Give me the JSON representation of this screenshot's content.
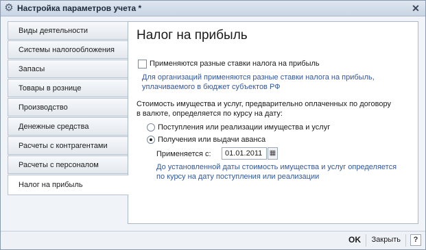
{
  "window": {
    "title": "Настройка параметров учета *"
  },
  "sidebar": {
    "items": [
      {
        "label": "Виды деятельности"
      },
      {
        "label": "Системы налогообложения"
      },
      {
        "label": "Запасы"
      },
      {
        "label": "Товары в рознице"
      },
      {
        "label": "Производство"
      },
      {
        "label": "Денежные средства"
      },
      {
        "label": "Расчеты с контрагентами"
      },
      {
        "label": "Расчеты с персоналом"
      },
      {
        "label": "Налог на прибыль",
        "active": true
      }
    ]
  },
  "main": {
    "title": "Налог на прибыль",
    "checkbox_label": "Применяются разные ставки налога на прибыль",
    "checkbox_checked": false,
    "checkbox_hint_line1": "Для организаций применяются разные ставки налога на прибыль,",
    "checkbox_hint_line2": "уплачиваемого в бюджет субъектов РФ",
    "paragraph_line1": "Стоимость имущества и услуг, предварительно оплаченных по договору",
    "paragraph_line2": "в валюте, определяется по курсу на дату:",
    "radio_options": [
      {
        "label": "Поступления или реализации имущества и услуг",
        "selected": false
      },
      {
        "label": "Получения или выдачи аванса",
        "selected": true
      }
    ],
    "date_label": "Применяется с:",
    "date_value": "01.01.2011",
    "date_hint_line1": "До установленной даты стоимость имущества и услуг определяется",
    "date_hint_line2": "по курсу на дату поступления или реализации"
  },
  "footer": {
    "ok_label": "OK",
    "close_label": "Закрыть",
    "help_label": "?"
  },
  "icons": {
    "app": "gear-icon",
    "close": "close-icon",
    "calendar": "calendar-icon"
  },
  "colors": {
    "hint": "#2f56a3"
  }
}
